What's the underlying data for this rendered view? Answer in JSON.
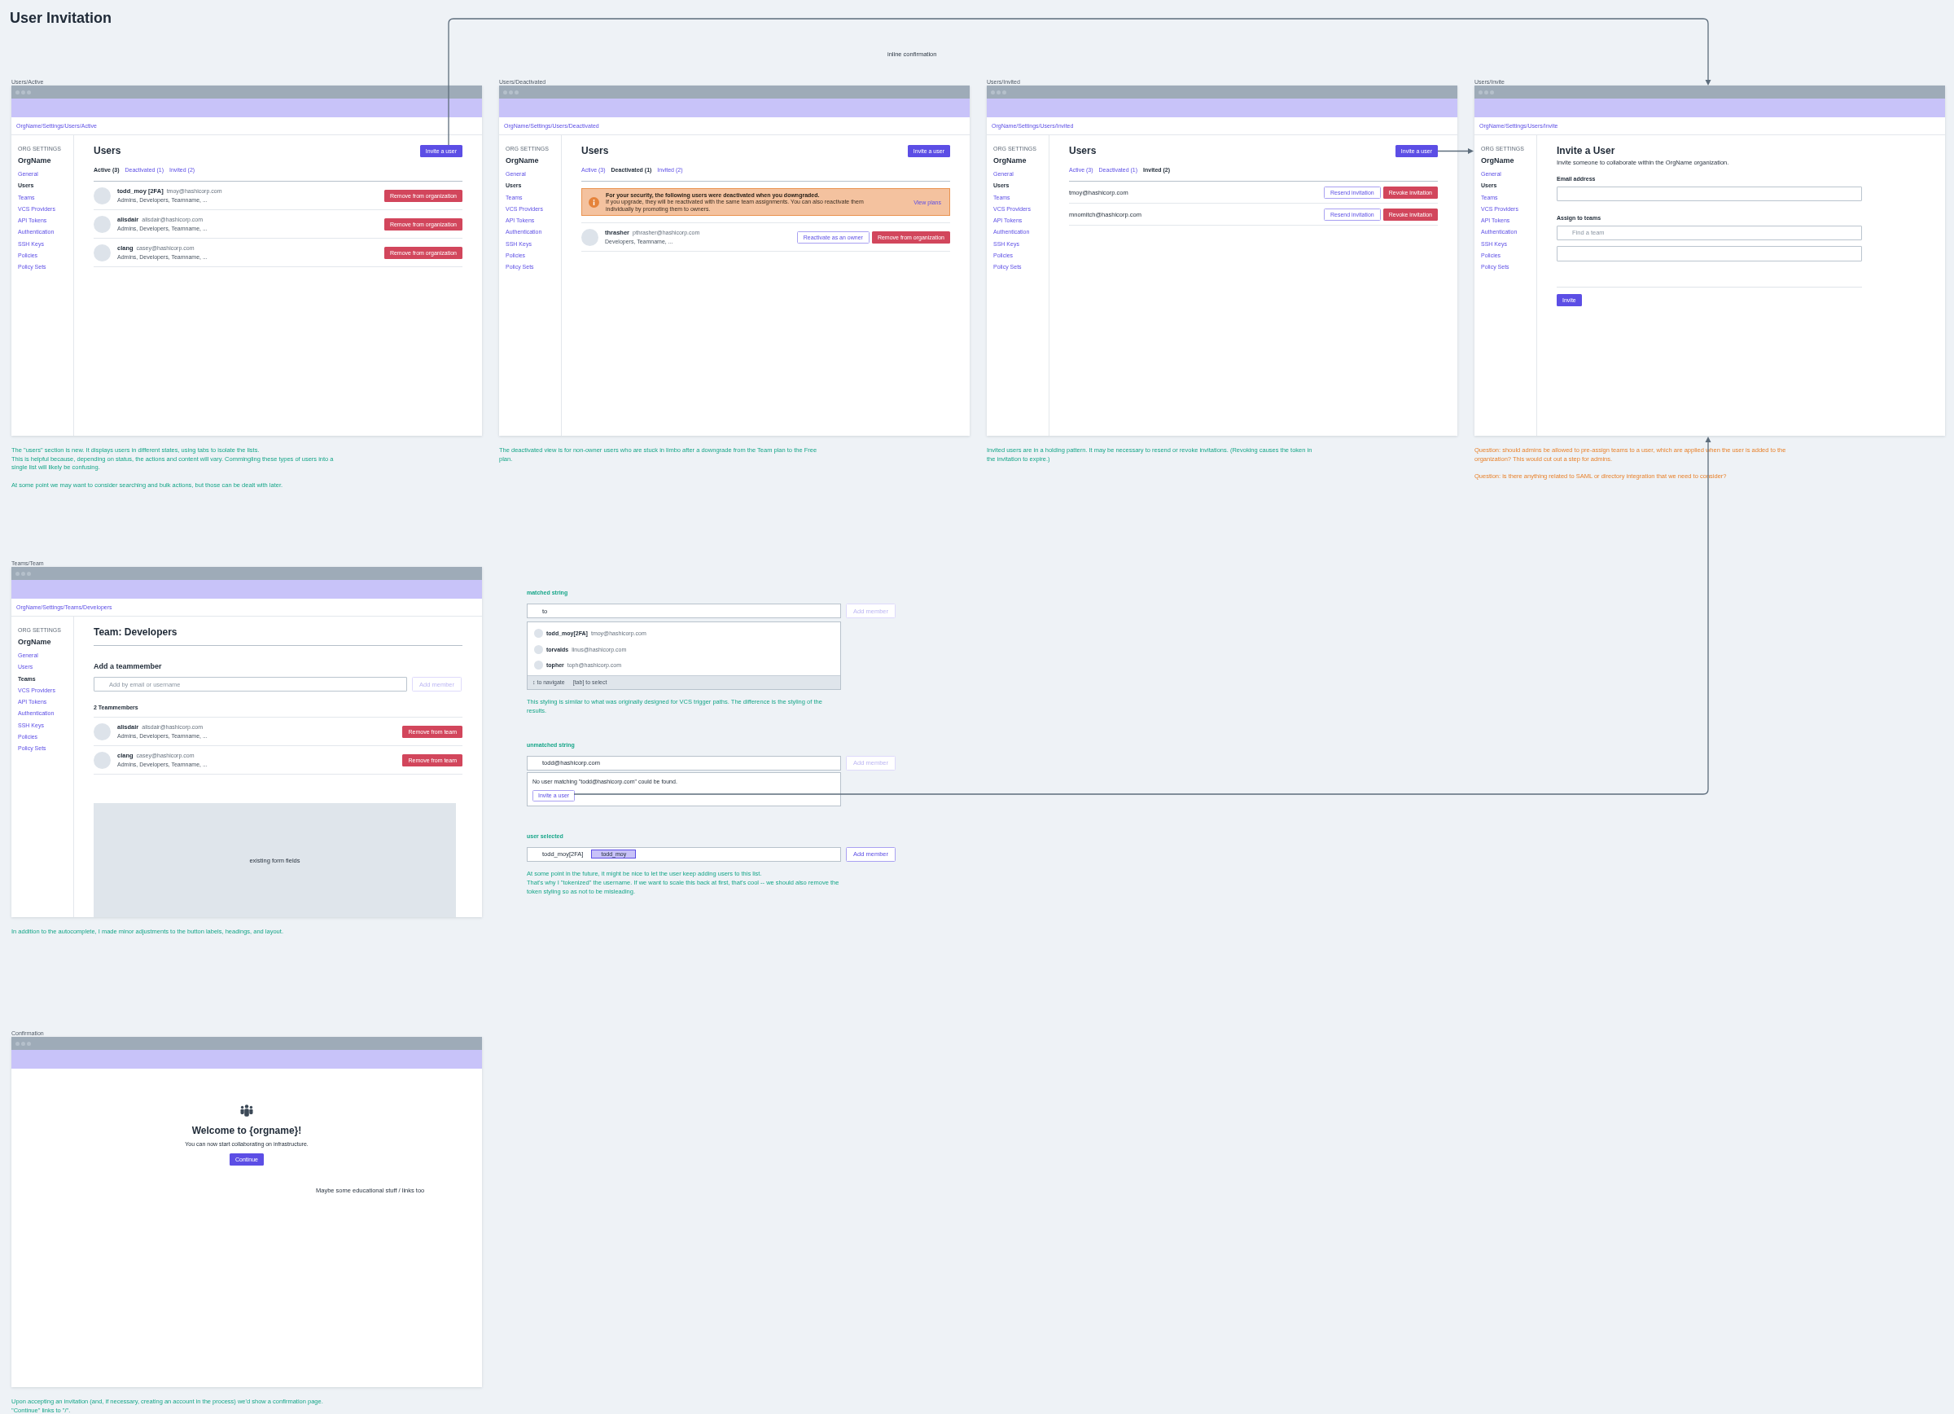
{
  "title": "User Invitation",
  "connector_label": "inline confirmation",
  "frames": [
    {
      "kind": "user_list",
      "label": "Users/Active",
      "breadcrumb": "OrgName/Settings/Users/Active",
      "sidebar": {
        "heading": "ORG SETTINGS",
        "org": "OrgName",
        "items": [
          {
            "label": "General",
            "selected": false
          },
          {
            "label": "Users",
            "selected": true
          },
          {
            "label": "Teams",
            "selected": false
          },
          {
            "label": "VCS Providers",
            "selected": false
          },
          {
            "label": "API Tokens",
            "selected": false
          },
          {
            "label": "Authentication",
            "selected": false
          },
          {
            "label": "SSH Keys",
            "selected": false
          },
          {
            "label": "Policies",
            "selected": false
          },
          {
            "label": "Policy Sets",
            "selected": false
          }
        ]
      },
      "heading": "Users",
      "invite_button": "Invite a user",
      "tabs": [
        {
          "label": "Active (3)",
          "selected": true
        },
        {
          "label": "Deactivated (1)",
          "selected": false
        },
        {
          "label": "Invited (2)",
          "selected": false
        }
      ],
      "rows": [
        {
          "kind": "member",
          "name": "todd_moy [2FA]",
          "email": "tmoy@hashicorp.com",
          "teams": "Admins, Developers, Teamname, ...",
          "actions": [
            {
              "label": "Remove from organization",
              "kind": "danger"
            }
          ]
        },
        {
          "kind": "member",
          "name": "alisdair",
          "email": "alisdair@hashicorp.com",
          "teams": "Admins, Developers, Teamname, ...",
          "actions": [
            {
              "label": "Remove from organization",
              "kind": "danger"
            }
          ]
        },
        {
          "kind": "member",
          "name": "clang",
          "email": "casey@hashicorp.com",
          "teams": "Admins, Developers, Teamname, ...",
          "actions": [
            {
              "label": "Remove from organization",
              "kind": "danger"
            }
          ]
        }
      ],
      "notes": [
        {
          "kind": "comment",
          "paragraphs": [
            "The \"users\" section is new. It displays users in different states, using tabs to isolate the lists.",
            "This is helpful because, depending on status, the actions and content will vary. Commingling these types of users into a single list will likely be confusing."
          ]
        },
        {
          "kind": "comment",
          "paragraphs": [
            "At some point we may want to consider searching and bulk actions, but those can be dealt with later."
          ]
        }
      ]
    },
    {
      "kind": "user_list",
      "label": "Users/Deactivated",
      "breadcrumb": "OrgName/Settings/Users/Deactivated",
      "sidebar": {
        "heading": "ORG SETTINGS",
        "org": "OrgName",
        "items": [
          {
            "label": "General",
            "selected": false
          },
          {
            "label": "Users",
            "selected": true
          },
          {
            "label": "Teams",
            "selected": false
          },
          {
            "label": "VCS Providers",
            "selected": false
          },
          {
            "label": "API Tokens",
            "selected": false
          },
          {
            "label": "Authentication",
            "selected": false
          },
          {
            "label": "SSH Keys",
            "selected": false
          },
          {
            "label": "Policies",
            "selected": false
          },
          {
            "label": "Policy Sets",
            "selected": false
          }
        ]
      },
      "heading": "Users",
      "invite_button": "Invite a user",
      "tabs": [
        {
          "label": "Active (3)",
          "selected": false
        },
        {
          "label": "Deactivated (1)",
          "selected": true
        },
        {
          "label": "Invited (2)",
          "selected": false
        }
      ],
      "alert": {
        "title": "For your security, the following users were deactivated when you downgraded.",
        "text": "If you upgrade, they will be reactivated with the same team assignments. You can also reactivate them individually by promoting them to owners.",
        "link": "View plans"
      },
      "rows": [
        {
          "kind": "member",
          "name": "thrasher",
          "email": "pthrasher@hashicorp.com",
          "teams": "Developers, Teamname, ...",
          "actions": [
            {
              "label": "Reactivate as an owner",
              "kind": "secondary"
            },
            {
              "label": "Remove from organization",
              "kind": "danger"
            }
          ]
        }
      ],
      "notes": [
        {
          "kind": "comment",
          "paragraphs": [
            "The deactivated view is for non-owner users who are stuck in limbo after a downgrade from the Team plan to the Free plan."
          ]
        }
      ]
    },
    {
      "kind": "user_list",
      "label": "Users/Invited",
      "breadcrumb": "OrgName/Settings/Users/Invited",
      "sidebar": {
        "heading": "ORG SETTINGS",
        "org": "OrgName",
        "items": [
          {
            "label": "General",
            "selected": false
          },
          {
            "label": "Users",
            "selected": true
          },
          {
            "label": "Teams",
            "selected": false
          },
          {
            "label": "VCS Providers",
            "selected": false
          },
          {
            "label": "API Tokens",
            "selected": false
          },
          {
            "label": "Authentication",
            "selected": false
          },
          {
            "label": "SSH Keys",
            "selected": false
          },
          {
            "label": "Policies",
            "selected": false
          },
          {
            "label": "Policy Sets",
            "selected": false
          }
        ]
      },
      "heading": "Users",
      "invite_button": "Invite a user",
      "tabs": [
        {
          "label": "Active (3)",
          "selected": false
        },
        {
          "label": "Deactivated (1)",
          "selected": false
        },
        {
          "label": "Invited (2)",
          "selected": true
        }
      ],
      "rows": [
        {
          "kind": "invite",
          "email": "tmoy@hashicorp.com",
          "actions": [
            {
              "label": "Resend invitation",
              "kind": "secondary"
            },
            {
              "label": "Revoke invitation",
              "kind": "danger"
            }
          ]
        },
        {
          "kind": "invite",
          "email": "mnomitch@hashicorp.com",
          "actions": [
            {
              "label": "Resend invitation",
              "kind": "secondary"
            },
            {
              "label": "Revoke invitation",
              "kind": "danger"
            }
          ]
        }
      ],
      "notes": [
        {
          "kind": "comment",
          "paragraphs": [
            "Invited users are in a holding pattern. It may be necessary to resend or revoke invitations. (Revoking causes the token in the invitation to expire.)"
          ]
        }
      ]
    },
    {
      "kind": "invite_form",
      "label": "Users/Invite",
      "breadcrumb": "OrgName/Settings/Users/Invite",
      "sidebar": {
        "heading": "ORG SETTINGS",
        "org": "OrgName",
        "items": [
          {
            "label": "General",
            "selected": false
          },
          {
            "label": "Users",
            "selected": true
          },
          {
            "label": "Teams",
            "selected": false
          },
          {
            "label": "VCS Providers",
            "selected": false
          },
          {
            "label": "API Tokens",
            "selected": false
          },
          {
            "label": "Authentication",
            "selected": false
          },
          {
            "label": "SSH Keys",
            "selected": false
          },
          {
            "label": "Policies",
            "selected": false
          },
          {
            "label": "Policy Sets",
            "selected": false
          }
        ]
      },
      "heading": "Invite a User",
      "subtitle": "Invite someone to collaborate within the OrgName organization.",
      "fields": [
        {
          "label": "Email address",
          "inputs": [
            {
              "kind": "text"
            }
          ]
        },
        {
          "label": "Assign to teams",
          "inputs": [
            {
              "kind": "search",
              "placeholder": "Find a team"
            },
            {
              "kind": "list"
            }
          ]
        }
      ],
      "submit_button": "Invite",
      "notes": [
        {
          "kind": "question",
          "paragraphs": [
            "Question: should admins be allowed to pre-assign teams to a user, which are applied when the user is added to the organization? This would cut out a step for admins."
          ]
        },
        {
          "kind": "question",
          "paragraphs": [
            "Question: is there anything related to SAML or directory integration that we need to consider?"
          ]
        }
      ]
    },
    {
      "kind": "team",
      "label": "Teams/Team",
      "breadcrumb": "OrgName/Settings/Teams/Developers",
      "sidebar": {
        "heading": "ORG SETTINGS",
        "org": "OrgName",
        "items": [
          {
            "label": "General",
            "selected": false
          },
          {
            "label": "Users",
            "selected": false
          },
          {
            "label": "Teams",
            "selected": true
          },
          {
            "label": "VCS Providers",
            "selected": false
          },
          {
            "label": "API Tokens",
            "selected": false
          },
          {
            "label": "Authentication",
            "selected": false
          },
          {
            "label": "SSH Keys",
            "selected": false
          },
          {
            "label": "Policies",
            "selected": false
          },
          {
            "label": "Policy Sets",
            "selected": false
          }
        ]
      },
      "heading": "Team: Developers",
      "add": {
        "heading": "Add a teammember",
        "placeholder": "Add by email or username",
        "button": {
          "label": "Add member",
          "disabled": true
        }
      },
      "members_heading": "2 Teammembers",
      "rows": [
        {
          "kind": "member",
          "name": "alisdair",
          "email": "alisdair@hashicorp.com",
          "teams": "Admins, Developers, Teamname, ...",
          "actions": [
            {
              "label": "Remove from team",
              "kind": "danger"
            }
          ]
        },
        {
          "kind": "member",
          "name": "clang",
          "email": "casey@hashicorp.com",
          "teams": "Admins, Developers, Teamname, ...",
          "actions": [
            {
              "label": "Remove from team",
              "kind": "danger"
            }
          ]
        }
      ],
      "placeholder_block": "existing form fields",
      "notes": [
        {
          "kind": "comment",
          "paragraphs": [
            "In addition to the autocomplete, I made minor adjustments to the button labels, headings, and layout."
          ]
        }
      ]
    },
    {
      "kind": "confirmation",
      "label": "Confirmation",
      "heading": "Welcome to {orgname}!",
      "text": "You can now start collaborating on infrastructure.",
      "button": "Continue",
      "aside": "Maybe some educational stuff / links too",
      "notes": [
        {
          "kind": "comment",
          "paragraphs": [
            "Upon accepting an invitation (and, if necessary, creating an account in the process) we'd show a confirmation page. \"Continue\" links to \"/\"."
          ]
        }
      ]
    }
  ],
  "autocomplete": {
    "states": [
      {
        "kind": "matched",
        "label": "matched string",
        "value": "to",
        "button": {
          "label": "Add member",
          "disabled": true
        },
        "suggestions": [
          {
            "name": "todd_moy[2FA]",
            "email": "tmoy@hashicorp.com"
          },
          {
            "name": "torvalds",
            "email": "linus@hashicorp.com"
          },
          {
            "name": "topher",
            "email": "toph@hashicorp.com"
          }
        ],
        "hints": [
          "↕ to navigate",
          "[tab] to select"
        ],
        "notes": [
          "This styling is similar to what was originally designed for VCS trigger paths. The difference is the styling of the results."
        ]
      },
      {
        "kind": "unmatched",
        "label": "unmatched string",
        "value": "todd@hashicorp.com",
        "button": {
          "label": "Add member",
          "disabled": true
        },
        "message": "No user matching \"todd@hashicorp.com\" could be found.",
        "action": "Invite a user"
      },
      {
        "kind": "selected",
        "label": "user selected",
        "value": "todd_moy[2FA]",
        "token": "todd_moy",
        "button": {
          "label": "Add member",
          "disabled": false
        },
        "notes": [
          "At some point in the future, it might be nice to let the user keep adding users to this list.",
          "That's why I \"tokenized\" the username. If we want to scale this back at first, that's cool -- we should also remove the token styling so as not to be misleading."
        ]
      }
    ]
  }
}
